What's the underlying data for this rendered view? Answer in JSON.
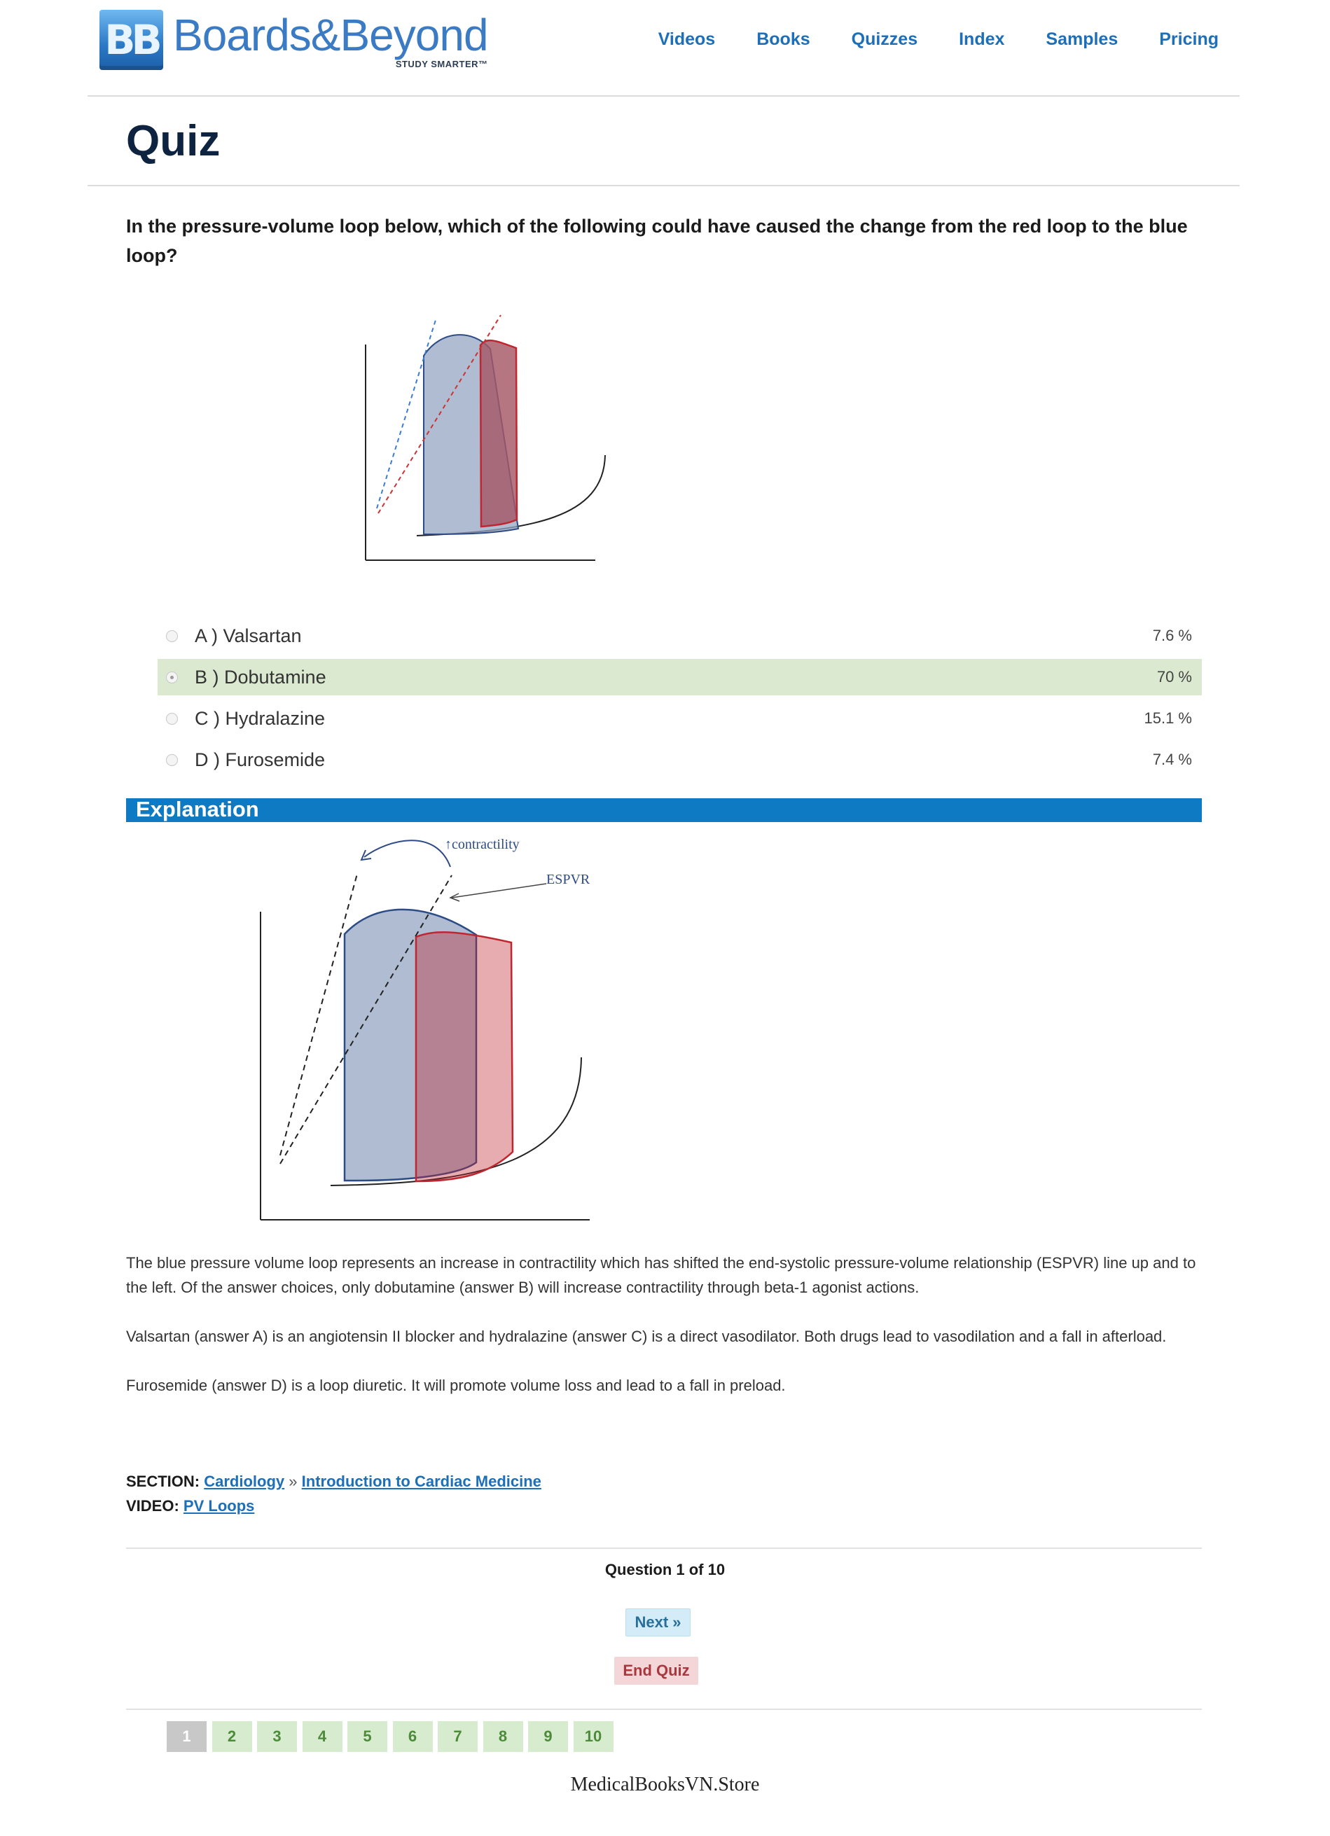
{
  "header": {
    "logo_badge": "BB",
    "logo_name": "Boards&Beyond",
    "logo_tagline": "STUDY SMARTER™",
    "nav": [
      "Videos",
      "Books",
      "Quizzes",
      "Index",
      "Samples",
      "Pricing"
    ]
  },
  "page_title": "Quiz",
  "question": "In the pressure-volume loop below, which of the following could have caused the change from the red loop to the blue loop?",
  "answers": [
    {
      "label": "A ) Valsartan",
      "percent": "7.6 %",
      "selected": false,
      "correct": false
    },
    {
      "label": "B ) Dobutamine",
      "percent": "70 %",
      "selected": true,
      "correct": true
    },
    {
      "label": "C ) Hydralazine",
      "percent": "15.1 %",
      "selected": false,
      "correct": false
    },
    {
      "label": "D ) Furosemide",
      "percent": "7.4 %",
      "selected": false,
      "correct": false
    }
  ],
  "explanation": {
    "title": "Explanation",
    "figure_labels": {
      "contractility": "↑contractility",
      "espvr": "ESPVR"
    },
    "paragraphs": [
      "The blue pressure volume loop represents an increase in contractility which has shifted the end-systolic pressure-volume relationship (ESPVR) line up and to the left. Of the answer choices, only dobutamine (answer B) will increase contractility through beta-1 agonist actions.",
      "Valsartan (answer A) is an angiotensin II blocker and hydralazine (answer C) is a direct vasodilator. Both drugs lead to vasodilation and a fall in afterload.",
      "Furosemide (answer D) is a loop diuretic. It will promote volume loss and lead to a fall in preload."
    ]
  },
  "meta": {
    "section_label": "SECTION:",
    "section_link_1": "Cardiology",
    "separator": "»",
    "section_link_2": "Introduction to Cardiac Medicine",
    "video_label": "VIDEO:",
    "video_link": "PV Loops"
  },
  "footer": {
    "question_count": "Question 1 of 10",
    "next_label": "Next »",
    "end_label": "End Quiz",
    "pages": [
      "1",
      "2",
      "3",
      "4",
      "5",
      "6",
      "7",
      "8",
      "9",
      "10"
    ],
    "watermark": "MedicalBooksVN.Store"
  },
  "colors": {
    "brand_blue": "#1c6fb8",
    "explanation_bar": "#0f7ac4",
    "correct_answer_bg": "#dbe9d1",
    "blue_loop": "#94a5c2",
    "red_loop": "#c0262f"
  }
}
